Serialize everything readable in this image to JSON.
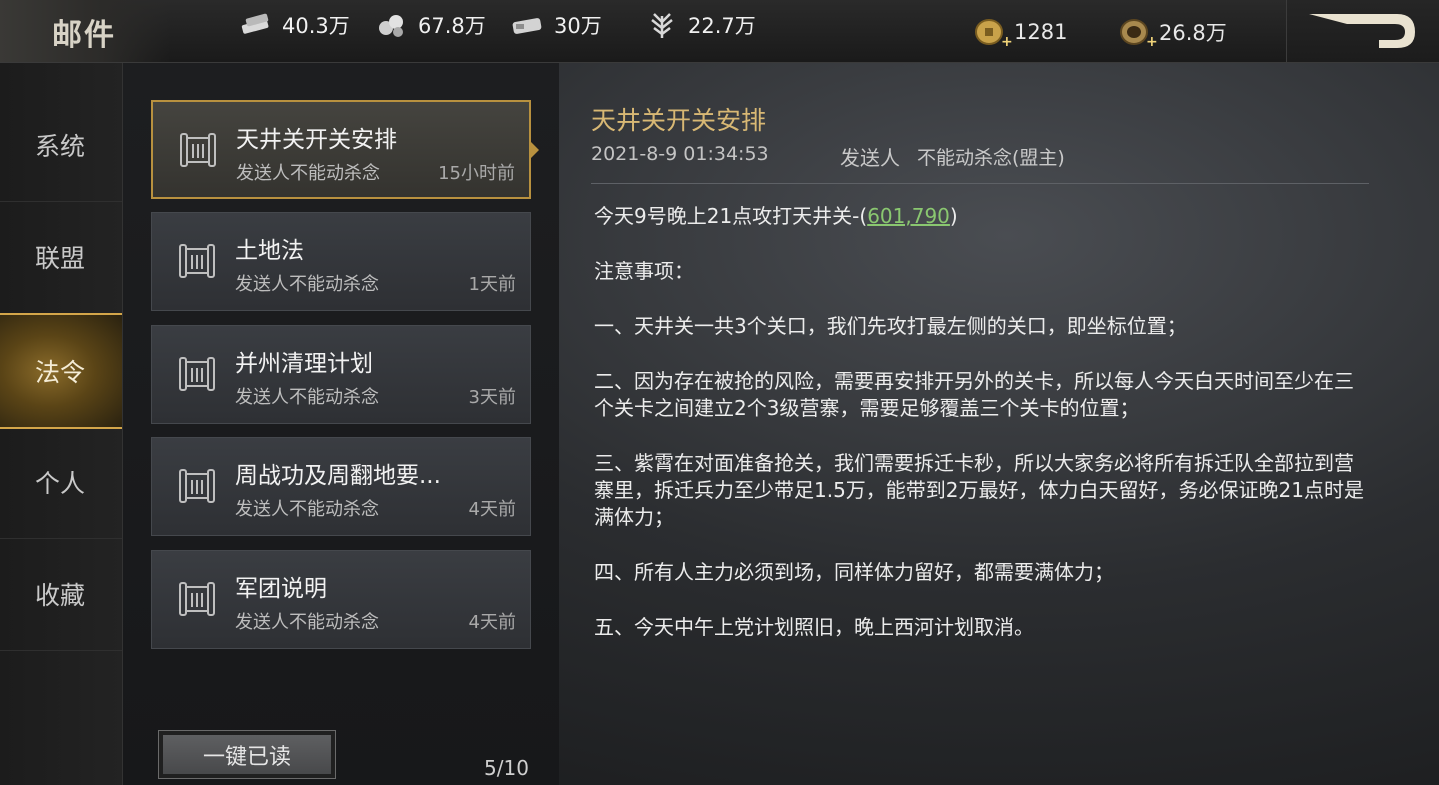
{
  "header": {
    "title": "邮件",
    "resources": [
      {
        "icon": "wood-icon",
        "value": "40.3万"
      },
      {
        "icon": "iron-icon",
        "value": "67.8万"
      },
      {
        "icon": "stone-icon",
        "value": "30万"
      },
      {
        "icon": "grain-icon",
        "value": "22.7万"
      }
    ],
    "currencies": [
      {
        "icon": "copper-coin-icon",
        "value": "1281"
      },
      {
        "icon": "gold-coin-icon",
        "value": "26.8万"
      }
    ],
    "back_icon": "back-arrow-icon"
  },
  "nav": {
    "items": [
      {
        "label": "系统"
      },
      {
        "label": "联盟"
      },
      {
        "label": "法令"
      },
      {
        "label": "个人"
      },
      {
        "label": "收藏"
      }
    ],
    "active": "法令"
  },
  "mail_list": {
    "items": [
      {
        "subject": "天井关开关安排",
        "from": "发送人不能动杀念",
        "time": "15小时前"
      },
      {
        "subject": "土地法",
        "from": "发送人不能动杀念",
        "time": "1天前"
      },
      {
        "subject": "并州清理计划",
        "from": "发送人不能动杀念",
        "time": "3天前"
      },
      {
        "subject": "周战功及周翻地要...",
        "from": "发送人不能动杀念",
        "time": "4天前"
      },
      {
        "subject": "军团说明",
        "from": "发送人不能动杀念",
        "time": "4天前"
      }
    ],
    "read_all_label": "一键已读",
    "page": "5/10"
  },
  "detail": {
    "title": "天井关开关安排",
    "date": "2021-8-9 01:34:53",
    "sender_label": "发送人",
    "sender": "不能动杀念(盟主)",
    "line1_prefix": "今天9号晚上21点攻打天井关-(",
    "line1_coord": "601,790",
    "line1_suffix": ")",
    "notes_heading": "注意事项：",
    "point1": "一、天井关一共3个关口，我们先攻打最左侧的关口，即坐标位置；",
    "point2": "二、因为存在被抢的风险，需要再安排开另外的关卡，所以每人今天白天时间至少在三个关卡之间建立2个3级营寨，需要足够覆盖三个关卡的位置；",
    "point3": "三、紫霄在对面准备抢关，我们需要拆迁卡秒，所以大家务必将所有拆迁队全部拉到营寨里，拆迁兵力至少带足1.5万，能带到2万最好，体力白天留好，务必保证晚21点时是满体力；",
    "point4": "四、所有人主力必须到场，同样体力留好，都需要满体力；",
    "point5": "五、今天中午上党计划照旧，晚上西河计划取消。"
  }
}
